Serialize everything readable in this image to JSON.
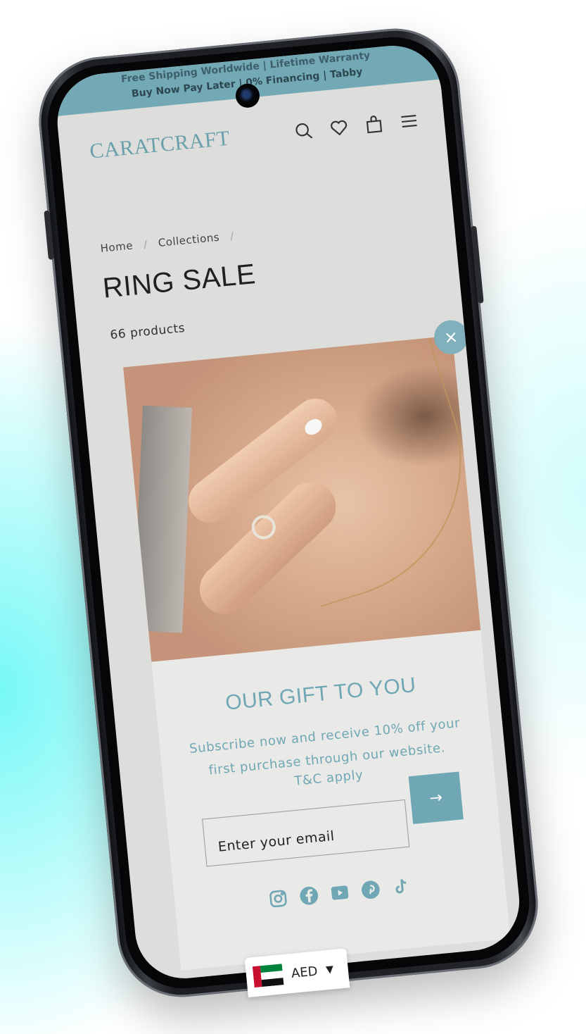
{
  "announcement": {
    "line1": "Free Shipping Worldwide | Lifetime Warranty",
    "line2": "Buy Now Pay Later | 0% Financing | Tabby"
  },
  "header": {
    "logo": "CARATCRAFT",
    "icons": [
      "search-icon",
      "heart-icon",
      "bag-icon",
      "menu-icon"
    ]
  },
  "breadcrumb": {
    "home": "Home",
    "collections": "Collections",
    "sep": "/"
  },
  "page": {
    "title": "RING SALE",
    "product_count": "66 products"
  },
  "modal": {
    "close_label": "×",
    "heading": "OUR GIFT TO YOU",
    "text": "Subscribe now and receive 10% off your first purchase through our website.",
    "tc": "T&C apply",
    "email_placeholder": "Enter your email",
    "submit_label": "→",
    "socials": [
      "instagram-icon",
      "facebook-icon",
      "youtube-icon",
      "pinterest-icon",
      "tiktok-icon"
    ]
  },
  "currency": {
    "code": "AED",
    "caret": "▼"
  },
  "colors": {
    "accent": "#6fa7b4",
    "announcement_bg": "#78b0bc",
    "screen_bg": "#e6e6e4"
  }
}
